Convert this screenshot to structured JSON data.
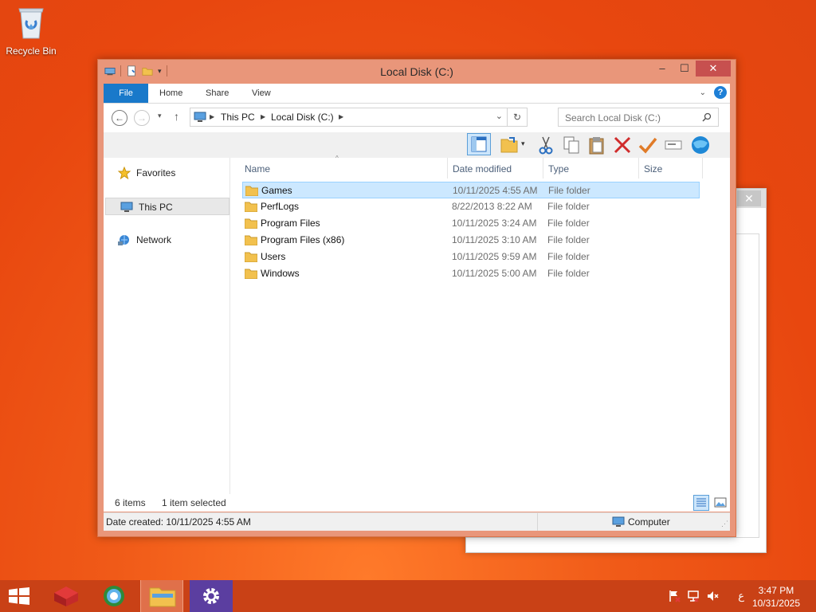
{
  "desktop": {
    "recycle_bin_label": "Recycle Bin"
  },
  "window": {
    "title": "Local Disk (C:)",
    "buttons": {
      "minimize": "–",
      "maximize": "☐",
      "close": "✕"
    }
  },
  "ribbon": {
    "tabs": [
      {
        "label": "File"
      },
      {
        "label": "Home"
      },
      {
        "label": "Share"
      },
      {
        "label": "View"
      }
    ],
    "help": "?"
  },
  "address_bar": {
    "crumbs": [
      "This PC",
      "Local Disk (C:)"
    ],
    "search_placeholder": "Search Local Disk (C:)"
  },
  "nav_pane": {
    "items": [
      {
        "label": "Favorites",
        "icon": "star-icon"
      },
      {
        "label": "This PC",
        "icon": "computer-icon",
        "selected": true
      },
      {
        "label": "Network",
        "icon": "network-icon"
      }
    ]
  },
  "file_list": {
    "columns": {
      "name": "Name",
      "date": "Date modified",
      "type": "Type",
      "size": "Size"
    },
    "rows": [
      {
        "name": "Games",
        "date": "10/11/2025 4:55 AM",
        "type": "File folder",
        "selected": true
      },
      {
        "name": "PerfLogs",
        "date": "8/22/2013 8:22 AM",
        "type": "File folder"
      },
      {
        "name": "Program Files",
        "date": "10/11/2025 3:24 AM",
        "type": "File folder"
      },
      {
        "name": "Program Files (x86)",
        "date": "10/11/2025 3:10 AM",
        "type": "File folder"
      },
      {
        "name": "Users",
        "date": "10/11/2025 9:59 AM",
        "type": "File folder"
      },
      {
        "name": "Windows",
        "date": "10/11/2025 5:00 AM",
        "type": "File folder"
      }
    ]
  },
  "status": {
    "item_count": "6 items",
    "selection": "1 item selected",
    "date_created": "Date created: 10/11/2025 4:55 AM",
    "location": "Computer"
  },
  "taskbar": {
    "ime": "ع",
    "time": "3:47 PM",
    "date": "10/31/2025"
  },
  "colors": {
    "accent": "#1979ca",
    "title_bar": "#e9967a",
    "taskbar": "#c94116",
    "selection": "#cce8ff"
  }
}
